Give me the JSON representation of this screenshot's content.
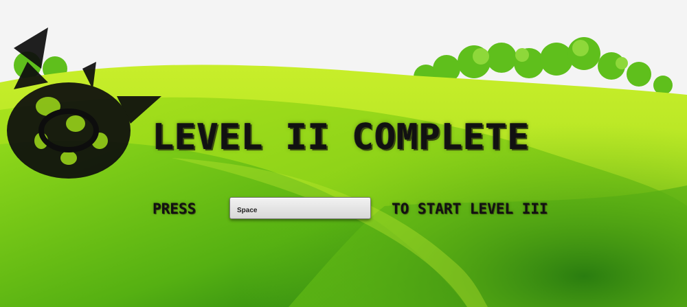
{
  "screen": {
    "title": "LEVEL II COMPLETE",
    "press_label": "PRESS",
    "key_value": "Space",
    "start_label": "TO START LEVEL III"
  },
  "icons": {
    "emblem": "spiked-wheel-logo-icon"
  },
  "colors": {
    "sky": "#f4f4f4",
    "grass_light": "#b6e61a",
    "grass_mid": "#7fcf1a",
    "grass_dark": "#2f8a12",
    "text": "#111111"
  }
}
